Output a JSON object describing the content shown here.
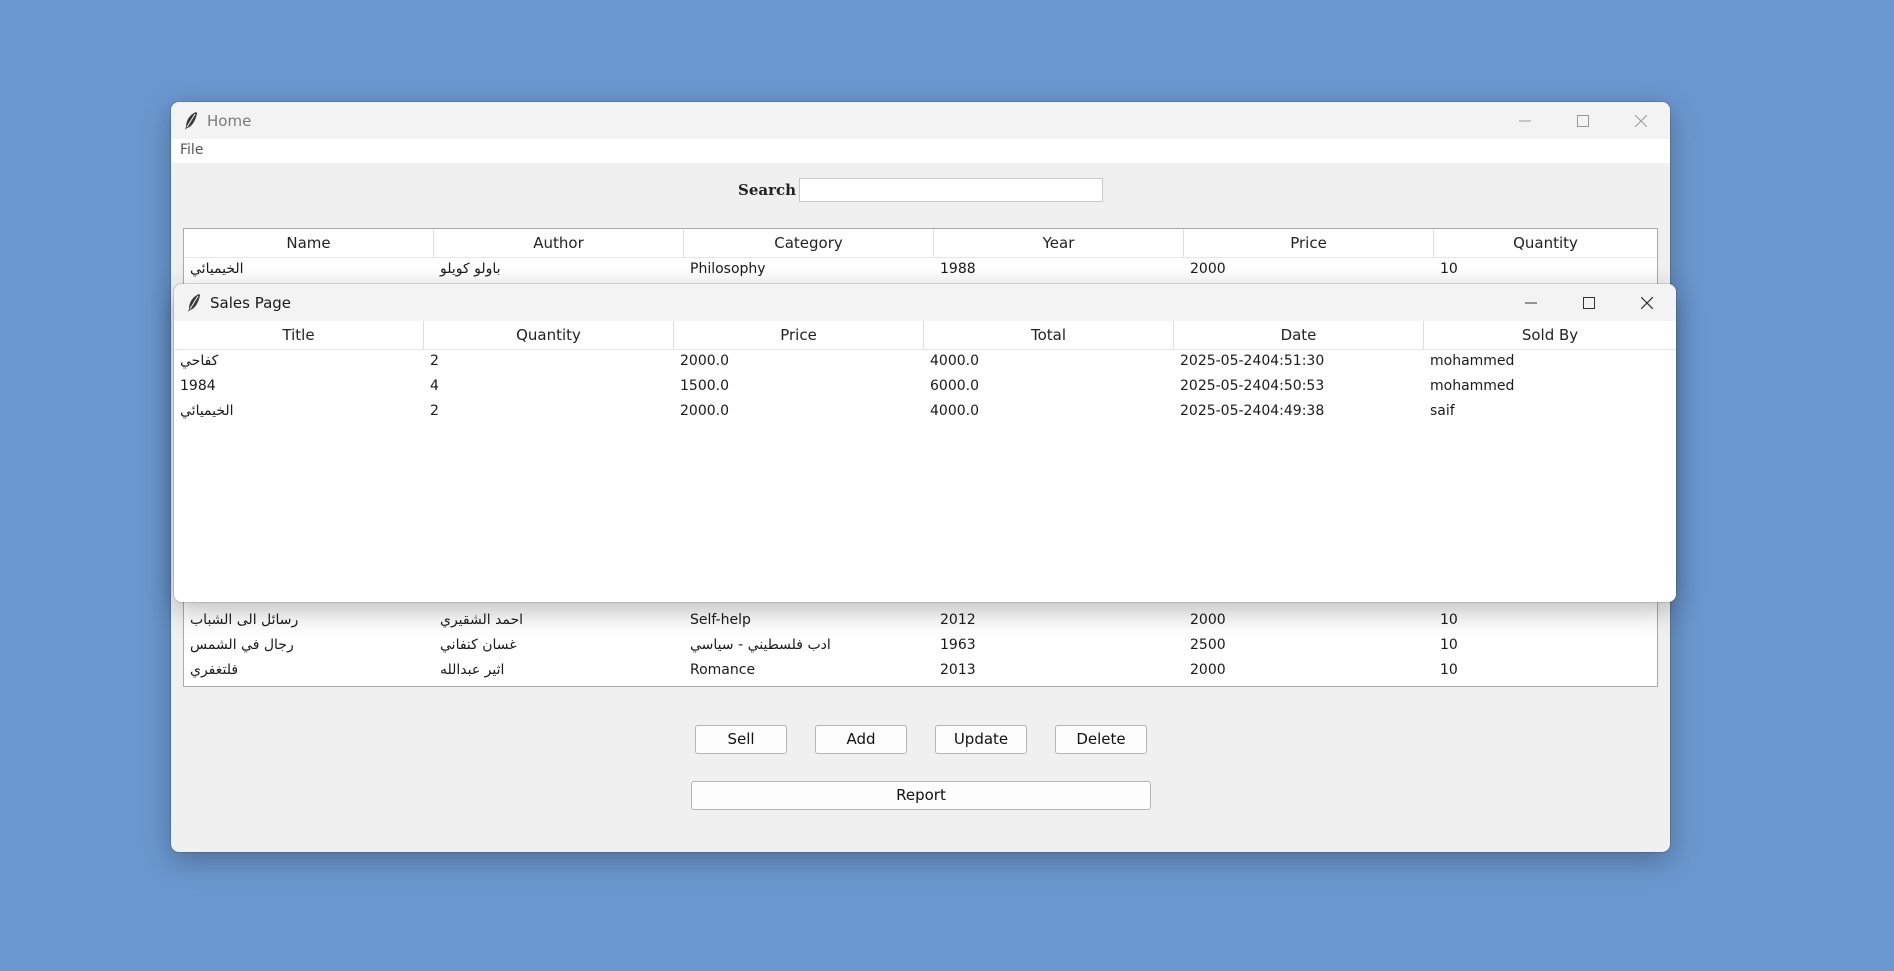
{
  "home": {
    "title": "Home",
    "menu": {
      "file": "File"
    },
    "search": {
      "label": "Search",
      "value": ""
    },
    "columns": [
      "Name",
      "Author",
      "Category",
      "Year",
      "Price",
      "Quantity"
    ],
    "rows": [
      [
        "الخيميائي",
        "باولو كويلو",
        "Philosophy",
        "1988",
        "2000",
        "10"
      ],
      [
        "رسائل الى الشباب",
        "احمد الشقيري",
        "Self-help",
        "2012",
        "2000",
        "10"
      ],
      [
        "رجال في الشمس",
        "غسان كنفاني",
        "ادب فلسطيني - سياسي",
        "1963",
        "2500",
        "10"
      ],
      [
        "فلتغفري",
        "اثير عبدالله",
        "Romance",
        "2013",
        "2000",
        "10"
      ]
    ],
    "buttons": {
      "sell": "Sell",
      "add": "Add",
      "update": "Update",
      "delete": "Delete",
      "report": "Report"
    }
  },
  "sales": {
    "title": "Sales Page",
    "columns": [
      "Title",
      "Quantity",
      "Price",
      "Total",
      "Date",
      "Sold By"
    ],
    "rows": [
      [
        "كفاحي",
        "2",
        "2000.0",
        "4000.0",
        "2025-05-2404:51:30",
        "mohammed"
      ],
      [
        "1984",
        "4",
        "1500.0",
        "6000.0",
        "2025-05-2404:50:53",
        "mohammed"
      ],
      [
        "الخيميائي",
        "2",
        "2000.0",
        "4000.0",
        "2025-05-2404:49:38",
        "saif"
      ]
    ]
  },
  "icons": {
    "app": "feather-icon",
    "minimize": "minimize-icon",
    "maximize": "maximize-icon",
    "close": "close-icon"
  },
  "colors": {
    "desktop": "#6a97cf",
    "window": "#f0f0f0",
    "table": "#ffffff"
  }
}
